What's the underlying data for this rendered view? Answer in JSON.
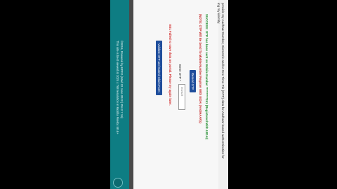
{
  "consent_text": [
    "provide my Aadhaar Number, Biometric and/or One Time Pin (OTP) data for Aadhaar based authentication for",
    "ing my identity."
  ],
  "success_message": "SUCCESS: OTP has been sent on Mobile Number **********261 (Registered With UIDAI)",
  "note_message": "(NOTE: OTP Will Be Send To Mobile Number Register With UIDAI (AADHAAR).)",
  "resend_button": "Resend OTP",
  "otp_label": "Enter OTP *",
  "otp_value": "302423",
  "error_message": "E01 Failed to save data on portal. Please try again later.",
  "validate_button": "Validate OTP and Submit Claim Form",
  "footer": [
    "©2019, Powered by EPFO (Wed 22 June 2022 | PM 2 7 19)",
    "This site is best viewed at 1024 x 768 resolution in Mozilla Firefox 58 &+"
  ]
}
